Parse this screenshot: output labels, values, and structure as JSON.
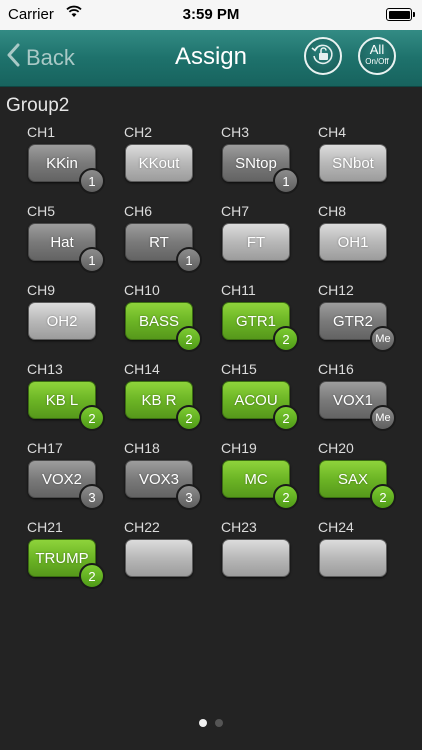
{
  "status": {
    "carrier": "Carrier",
    "time": "3:59 PM"
  },
  "nav": {
    "back": "Back",
    "title": "Assign",
    "all": "All",
    "onoff": "On/Off"
  },
  "group": "Group2",
  "channels": [
    {
      "label": "CH1",
      "name": "KKin",
      "style": "gray",
      "badge": "1"
    },
    {
      "label": "CH2",
      "name": "KKout",
      "style": "light",
      "badge": ""
    },
    {
      "label": "CH3",
      "name": "SNtop",
      "style": "gray",
      "badge": "1"
    },
    {
      "label": "CH4",
      "name": "SNbot",
      "style": "light",
      "badge": ""
    },
    {
      "label": "CH5",
      "name": "Hat",
      "style": "gray",
      "badge": "1"
    },
    {
      "label": "CH6",
      "name": "RT",
      "style": "gray",
      "badge": "1"
    },
    {
      "label": "CH7",
      "name": "FT",
      "style": "light",
      "badge": ""
    },
    {
      "label": "CH8",
      "name": "OH1",
      "style": "light",
      "badge": ""
    },
    {
      "label": "CH9",
      "name": "OH2",
      "style": "light",
      "badge": ""
    },
    {
      "label": "CH10",
      "name": "BASS",
      "style": "green",
      "badge": "2"
    },
    {
      "label": "CH11",
      "name": "GTR1",
      "style": "green",
      "badge": "2"
    },
    {
      "label": "CH12",
      "name": "GTR2",
      "style": "gray",
      "badge": "Me"
    },
    {
      "label": "CH13",
      "name": "KB L",
      "style": "green",
      "badge": "2"
    },
    {
      "label": "CH14",
      "name": "KB R",
      "style": "green",
      "badge": "2"
    },
    {
      "label": "CH15",
      "name": "ACOU",
      "style": "green",
      "badge": "2"
    },
    {
      "label": "CH16",
      "name": "VOX1",
      "style": "gray",
      "badge": "Me"
    },
    {
      "label": "CH17",
      "name": "VOX2",
      "style": "gray",
      "badge": "3"
    },
    {
      "label": "CH18",
      "name": "VOX3",
      "style": "gray",
      "badge": "3"
    },
    {
      "label": "CH19",
      "name": "MC",
      "style": "green",
      "badge": "2"
    },
    {
      "label": "CH20",
      "name": "SAX",
      "style": "green",
      "badge": "2"
    },
    {
      "label": "CH21",
      "name": "TRUMP",
      "style": "green",
      "badge": "2"
    },
    {
      "label": "CH22",
      "name": "",
      "style": "light",
      "badge": ""
    },
    {
      "label": "CH23",
      "name": "",
      "style": "light",
      "badge": ""
    },
    {
      "label": "CH24",
      "name": "",
      "style": "light",
      "badge": ""
    }
  ],
  "colors": {
    "nav_bg": "#1e726c",
    "green": "#6cb525",
    "gray": "#7a7a7a",
    "background": "#232323"
  },
  "pages": {
    "count": 2,
    "active": 0
  }
}
